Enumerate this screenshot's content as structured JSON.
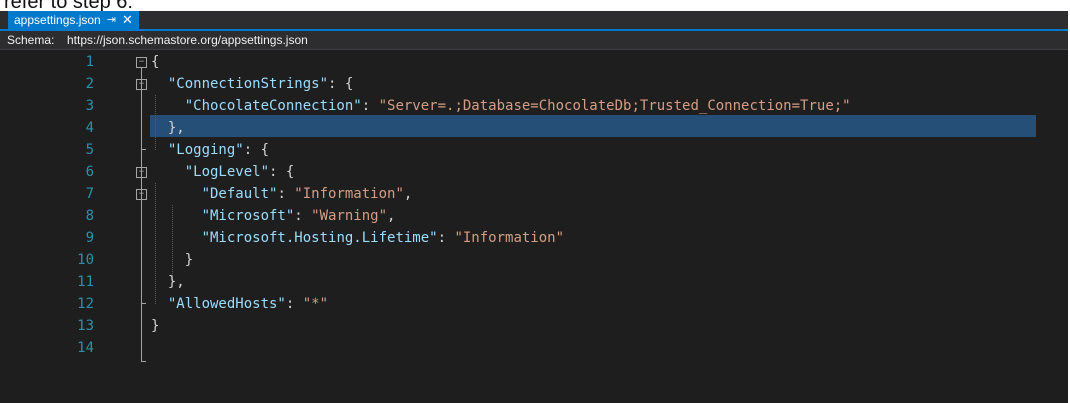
{
  "caption": "refer to step 6:",
  "tab": {
    "title": "appsettings.json",
    "pin_icon": "pin-icon",
    "close_icon": "close-icon"
  },
  "schema": {
    "label": "Schema:",
    "url": "https://json.schemastore.org/appsettings.json"
  },
  "editor": {
    "selected_line": 3,
    "lines": [
      {
        "num": "1",
        "tokens": [
          {
            "t": "{",
            "c": "p"
          }
        ]
      },
      {
        "num": "2",
        "tokens": [
          {
            "t": "  ",
            "c": "p"
          },
          {
            "t": "\"ConnectionStrings\"",
            "c": "k"
          },
          {
            "t": ": {",
            "c": "p"
          }
        ]
      },
      {
        "num": "3",
        "tokens": [
          {
            "t": "    ",
            "c": "p"
          },
          {
            "t": "\"ChocolateConnection\"",
            "c": "k"
          },
          {
            "t": ": ",
            "c": "p"
          },
          {
            "t": "\"Server=.;Database=ChocolateDb;Trusted_Connection=True;\"",
            "c": "s"
          }
        ]
      },
      {
        "num": "4",
        "tokens": [
          {
            "t": "  },",
            "c": "p"
          }
        ]
      },
      {
        "num": "5",
        "tokens": [
          {
            "t": "  ",
            "c": "p"
          },
          {
            "t": "\"Logging\"",
            "c": "k"
          },
          {
            "t": ": {",
            "c": "p"
          }
        ]
      },
      {
        "num": "6",
        "tokens": [
          {
            "t": "    ",
            "c": "p"
          },
          {
            "t": "\"LogLevel\"",
            "c": "k"
          },
          {
            "t": ": {",
            "c": "p"
          }
        ]
      },
      {
        "num": "7",
        "tokens": [
          {
            "t": "      ",
            "c": "p"
          },
          {
            "t": "\"Default\"",
            "c": "k"
          },
          {
            "t": ": ",
            "c": "p"
          },
          {
            "t": "\"Information\"",
            "c": "s"
          },
          {
            "t": ",",
            "c": "p"
          }
        ]
      },
      {
        "num": "8",
        "tokens": [
          {
            "t": "      ",
            "c": "p"
          },
          {
            "t": "\"Microsoft\"",
            "c": "k"
          },
          {
            "t": ": ",
            "c": "p"
          },
          {
            "t": "\"Warning\"",
            "c": "s"
          },
          {
            "t": ",",
            "c": "p"
          }
        ]
      },
      {
        "num": "9",
        "tokens": [
          {
            "t": "      ",
            "c": "p"
          },
          {
            "t": "\"Microsoft.Hosting.Lifetime\"",
            "c": "k"
          },
          {
            "t": ": ",
            "c": "p"
          },
          {
            "t": "\"Information\"",
            "c": "s"
          }
        ]
      },
      {
        "num": "10",
        "tokens": [
          {
            "t": "    }",
            "c": "p"
          }
        ]
      },
      {
        "num": "11",
        "tokens": [
          {
            "t": "  },",
            "c": "p"
          }
        ]
      },
      {
        "num": "12",
        "tokens": [
          {
            "t": "  ",
            "c": "p"
          },
          {
            "t": "\"AllowedHosts\"",
            "c": "k"
          },
          {
            "t": ": ",
            "c": "p"
          },
          {
            "t": "\"*\"",
            "c": "s"
          }
        ]
      },
      {
        "num": "13",
        "tokens": [
          {
            "t": "}",
            "c": "p"
          }
        ]
      },
      {
        "num": "14",
        "tokens": []
      }
    ]
  },
  "colors": {
    "accent": "#007acc",
    "editor_bg": "#1e1e1e",
    "line_number": "#2b91af",
    "key": "#9cdcfe",
    "string": "#d69d85",
    "selection": "#264f78"
  }
}
